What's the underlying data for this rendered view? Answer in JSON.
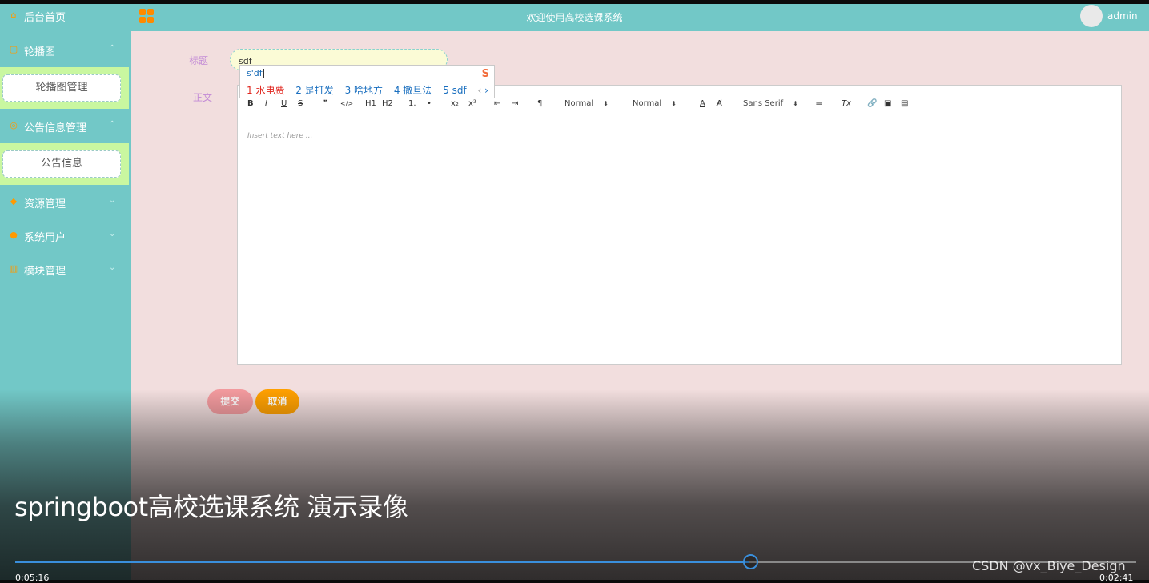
{
  "header": {
    "welcome": "欢迎使用高校选课系统",
    "username": "admin"
  },
  "sidebar": {
    "items": [
      {
        "label": "后台首页",
        "icon": "home-icon"
      },
      {
        "label": "轮播图",
        "icon": "image-icon",
        "expanded": true,
        "sub": [
          "轮播图管理"
        ]
      },
      {
        "label": "公告信息管理",
        "icon": "notice-icon",
        "expanded": true,
        "sub": [
          "公告信息"
        ]
      },
      {
        "label": "资源管理",
        "icon": "resource-icon"
      },
      {
        "label": "系统用户",
        "icon": "user-icon"
      },
      {
        "label": "模块管理",
        "icon": "module-icon"
      }
    ]
  },
  "form": {
    "title_label": "标题",
    "title_value": "sdf",
    "body_label": "正文",
    "body_placeholder": "Insert text here ..."
  },
  "editor_toolbar": {
    "buttons": [
      "B",
      "I",
      "U",
      "S",
      "❞",
      "</>",
      "H1",
      "H2",
      "1.",
      "•",
      "x₂",
      "x²",
      "⇤",
      "⇥",
      "¶",
      "A",
      "A̸",
      "Tx",
      "🔗",
      "▣",
      "▤"
    ],
    "size_select": "Normal",
    "header_select": "Normal",
    "font_select": "Sans Serif"
  },
  "ime": {
    "pinyin": "s'df",
    "candidates": [
      "1 水电费",
      "2 是打发",
      "3 啥地方",
      "4 撒旦法",
      "5 sdf"
    ],
    "nav_prev": "‹",
    "nav_next": "›",
    "brand": "S"
  },
  "buttons": {
    "submit": "提交",
    "cancel": "取消"
  },
  "player": {
    "title": "springboot高校选课系统 演示录像",
    "current_time": "0:05:16",
    "remaining_time": "0:02:41",
    "progress": 0.654,
    "watermark": "CSDN @vx_Biye_Design"
  },
  "colors": {
    "sidebar_bg": "#72c8c7",
    "submenu_bg": "#c9f7a0",
    "content_bg": "#f2dede",
    "submit": "#f39a9e",
    "cancel": "#ffa000",
    "progress": "#3a8fdc"
  }
}
